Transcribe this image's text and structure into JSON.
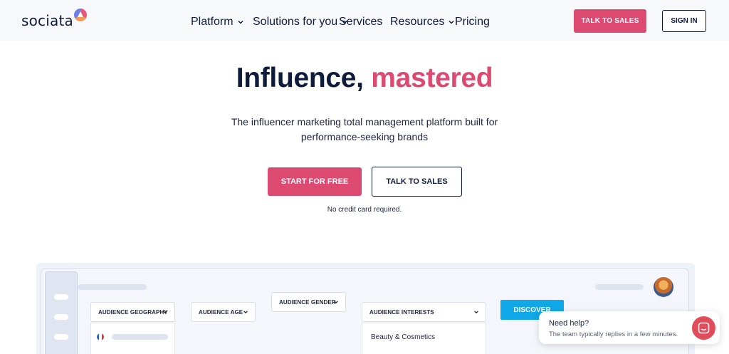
{
  "header": {
    "logo": "sociata",
    "nav": [
      {
        "label": "Platform",
        "has_dropdown": true
      },
      {
        "label": "Solutions for you",
        "has_dropdown": true
      },
      {
        "label": "Services",
        "has_dropdown": false
      },
      {
        "label": "Resources",
        "has_dropdown": true
      },
      {
        "label": "Pricing",
        "has_dropdown": false
      }
    ],
    "talk_to_sales": "TALK TO SALES",
    "sign_in": "SIGN IN"
  },
  "hero": {
    "title_main": "Influence,",
    "title_accent": "mastered",
    "subtitle_line1": "The influencer marketing total management platform built for",
    "subtitle_line2": "performance-seeking brands",
    "start_button": "START FOR FREE",
    "talk_button": "TALK TO SALES",
    "note": "No credit card required."
  },
  "dashboard": {
    "filters": [
      {
        "label": "AUDIENCE GEOGRAPHY"
      },
      {
        "label": "AUDIENCE AGE"
      },
      {
        "label": "AUDIENCE GENDER"
      },
      {
        "label": "AUDIENCE INTERESTS"
      }
    ],
    "interest_option": "Beauty & Cosmetics",
    "discover": "DISCOVER"
  },
  "chat": {
    "title": "Need help?",
    "subtitle": "The team typically replies in a few minutes."
  },
  "colors": {
    "brand_pink": "#dc4a71",
    "navy": "#0f1b3d",
    "discover_blue": "#10a8e8",
    "chat_red": "#e14c5a"
  }
}
